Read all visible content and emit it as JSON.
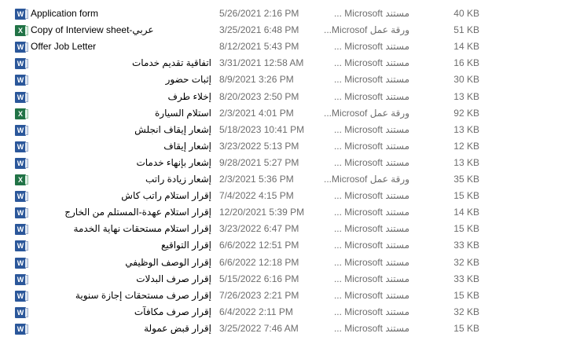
{
  "files": [
    {
      "name": "Application form",
      "date": "5/26/2021 2:16 PM",
      "type": "مستند Microsoft ...",
      "size": "40 KB",
      "icon": "word-document-icon"
    },
    {
      "name": "Copy of Interview sheet-عربي",
      "date": "3/25/2021 6:48 PM",
      "type": "ورقة عمل Microsof...",
      "size": "51 KB",
      "icon": "excel-worksheet-icon"
    },
    {
      "name": "Offer Job Letter",
      "date": "8/12/2021 5:43 PM",
      "type": "مستند Microsoft ...",
      "size": "14 KB",
      "icon": "word-document-icon"
    },
    {
      "name": "اتفاقية تقديم خدمات",
      "date": "3/31/2021 12:58 AM",
      "type": "مستند Microsoft ...",
      "size": "16 KB",
      "icon": "word-document-icon"
    },
    {
      "name": "إثبات حضور",
      "date": "8/9/2021 3:26 PM",
      "type": "مستند Microsoft ...",
      "size": "30 KB",
      "icon": "word-document-icon"
    },
    {
      "name": "إخلاء طرف",
      "date": "8/20/2023 2:50 PM",
      "type": "مستند Microsoft ...",
      "size": "13 KB",
      "icon": "word-document-icon"
    },
    {
      "name": "استلام السيارة",
      "date": "2/3/2021 4:01 PM",
      "type": "ورقة عمل Microsof...",
      "size": "92 KB",
      "icon": "excel-worksheet-icon"
    },
    {
      "name": "إشعار إيقاف انجلش",
      "date": "5/18/2023 10:41 PM",
      "type": "مستند Microsoft ...",
      "size": "13 KB",
      "icon": "word-document-icon"
    },
    {
      "name": "إشعار إيقاف",
      "date": "3/23/2022 5:13 PM",
      "type": "مستند Microsoft ...",
      "size": "12 KB",
      "icon": "word-document-icon"
    },
    {
      "name": "إشعار بإنهاء خدمات",
      "date": "9/28/2021 5:27 PM",
      "type": "مستند Microsoft ...",
      "size": "13 KB",
      "icon": "word-document-icon"
    },
    {
      "name": "إشعار زيادة راتب",
      "date": "2/3/2021 5:36 PM",
      "type": "ورقة عمل Microsof...",
      "size": "35 KB",
      "icon": "excel-worksheet-icon"
    },
    {
      "name": "إقرار استلام راتب كاش",
      "date": "7/4/2022 4:15 PM",
      "type": "مستند Microsoft ...",
      "size": "15 KB",
      "icon": "word-document-icon"
    },
    {
      "name": "إقرار استلام عهدة-المستلم من الخارج",
      "date": "12/20/2021 5:39 PM",
      "type": "مستند Microsoft ...",
      "size": "14 KB",
      "icon": "word-document-icon"
    },
    {
      "name": "إقرار استلام مستحقات نهاية الخدمة",
      "date": "3/23/2022 6:47 PM",
      "type": "مستند Microsoft ...",
      "size": "15 KB",
      "icon": "word-document-icon"
    },
    {
      "name": "إقرار التواقيع",
      "date": "6/6/2022 12:51 PM",
      "type": "مستند Microsoft ...",
      "size": "33 KB",
      "icon": "word-document-icon"
    },
    {
      "name": "إقرار الوصف الوظيفي",
      "date": "6/6/2022 12:18 PM",
      "type": "مستند Microsoft ...",
      "size": "32 KB",
      "icon": "word-document-icon"
    },
    {
      "name": "إقرار صرف البدلات",
      "date": "5/15/2022 6:16 PM",
      "type": "مستند Microsoft ...",
      "size": "33 KB",
      "icon": "word-document-icon"
    },
    {
      "name": "إقرار صرف مستحقات إجازة سنوية",
      "date": "7/26/2023 2:21 PM",
      "type": "مستند Microsoft ...",
      "size": "15 KB",
      "icon": "word-document-icon"
    },
    {
      "name": "إقرار صرف مكافآت",
      "date": "6/4/2022 2:11 PM",
      "type": "مستند Microsoft ...",
      "size": "32 KB",
      "icon": "word-document-icon"
    },
    {
      "name": "إقرار قبض عمولة",
      "date": "3/25/2022 7:46 AM",
      "type": "مستند Microsoft ...",
      "size": "15 KB",
      "icon": "word-document-icon"
    }
  ]
}
